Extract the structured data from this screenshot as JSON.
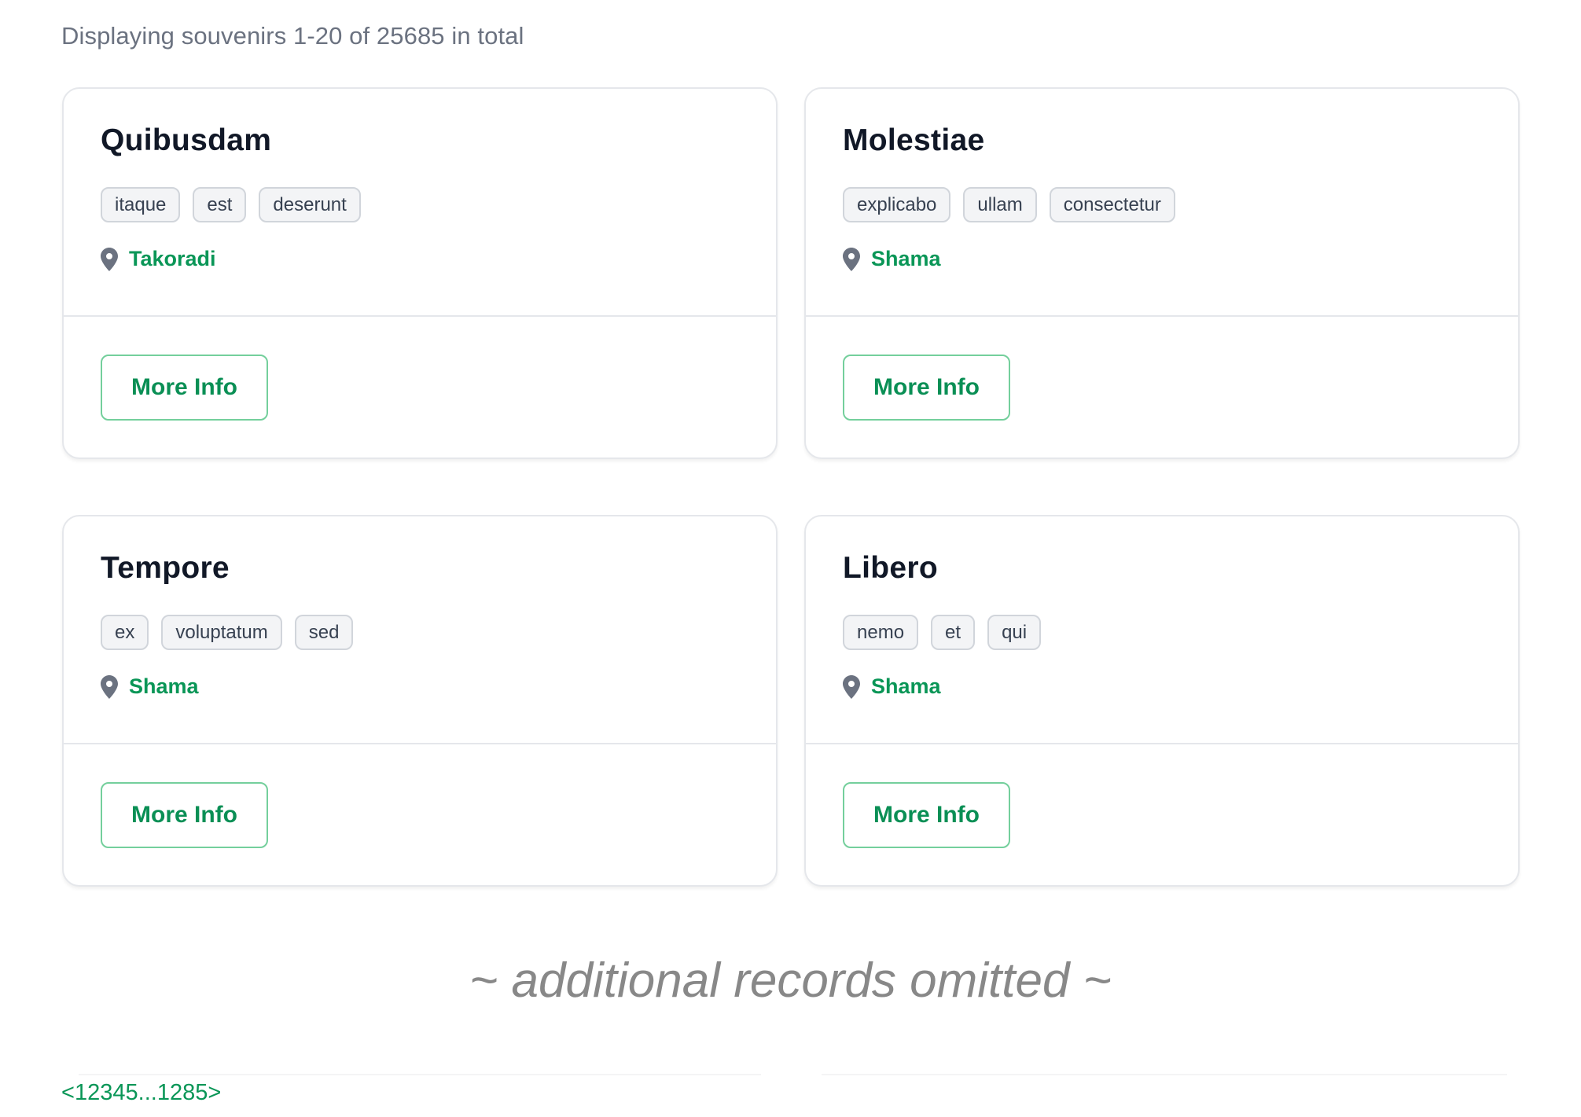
{
  "summary": "Displaying souvenirs 1-20 of 25685 in total",
  "colors": {
    "accent_green": "#0a9657",
    "button_border": "#74cf9c",
    "muted_text": "#6b7280",
    "tag_bg": "#f3f4f6",
    "tag_border": "#d1d5db"
  },
  "cards": [
    {
      "title": "Quibusdam",
      "tags": [
        "itaque",
        "est",
        "deserunt"
      ],
      "location": "Takoradi",
      "location_icon": "map-pin-icon",
      "button": "More Info"
    },
    {
      "title": "Molestiae",
      "tags": [
        "explicabo",
        "ullam",
        "consectetur"
      ],
      "location": "Shama",
      "location_icon": "map-pin-icon",
      "button": "More Info"
    },
    {
      "title": "Tempore",
      "tags": [
        "ex",
        "voluptatum",
        "sed"
      ],
      "location": "Shama",
      "location_icon": "map-pin-icon",
      "button": "More Info"
    },
    {
      "title": "Libero",
      "tags": [
        "nemo",
        "et",
        "qui"
      ],
      "location": "Shama",
      "location_icon": "map-pin-icon",
      "button": "More Info"
    }
  ],
  "omitted_notice": "~ additional records omitted ~",
  "pagination": {
    "prev": "<",
    "pages": [
      "1",
      "2",
      "3",
      "4",
      "5"
    ],
    "ellipsis": "...",
    "last": "1285",
    "next": ">"
  }
}
